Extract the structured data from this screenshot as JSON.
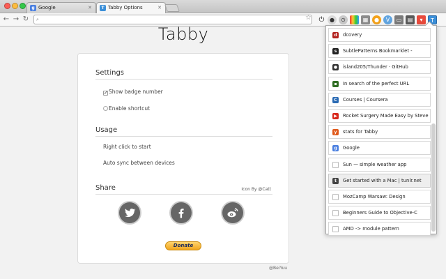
{
  "browser": {
    "tabs": [
      {
        "label": "Google",
        "fav": "g"
      },
      {
        "label": "Tabby Options",
        "fav": "T"
      }
    ],
    "omnibox": {
      "value": ""
    }
  },
  "page": {
    "title": "Tabby",
    "settings": {
      "heading": "Settings",
      "show_badge": "Show badge number",
      "enable_shortcut": "Enable shortcut"
    },
    "usage": {
      "heading": "Usage",
      "line1": "Right click to start",
      "line2": "Auto sync between devices"
    },
    "share": {
      "heading": "Share",
      "icon_by": "Icon By @Catt"
    },
    "donate_label": "Donate",
    "credit": "@BeiYuu"
  },
  "popup": {
    "items": [
      {
        "label": "dcovery",
        "icon_color": "#b3231f",
        "glyph": "d"
      },
      {
        "label": "SubtlePatterns Bookmarklet -",
        "icon_color": "#222222",
        "glyph": "s"
      },
      {
        "label": "island205/Thunder · GitHub",
        "icon_color": "#333333",
        "glyph": "●"
      },
      {
        "label": "In search of the perfect URL",
        "icon_color": "#2f6d23",
        "glyph": "▪"
      },
      {
        "label": "Courses | Coursera",
        "icon_color": "#2a6ab3",
        "glyph": "C"
      },
      {
        "label": "Rocket Surgery Made Easy by Steve",
        "icon_color": "#d8281c",
        "glyph": "▶"
      },
      {
        "label": "stats for Tabby",
        "icon_color": "#e05a1c",
        "glyph": "y"
      },
      {
        "label": "Google",
        "icon_color": "#4a7fe0",
        "glyph": "g"
      },
      {
        "label": "Sun — simple weather app",
        "icon_color": "#bbbbbb",
        "glyph": ""
      },
      {
        "label": "Get started with a Mac | tunlr.net",
        "icon_color": "#444444",
        "glyph": "t"
      },
      {
        "label": "MozCamp Warsaw: Design",
        "icon_color": "#bbbbbb",
        "glyph": ""
      },
      {
        "label": "Beginners Guide to Objective-C",
        "icon_color": "#bbbbbb",
        "glyph": ""
      },
      {
        "label": "AMD -> module pattern",
        "icon_color": "#bbbbbb",
        "glyph": ""
      }
    ]
  }
}
